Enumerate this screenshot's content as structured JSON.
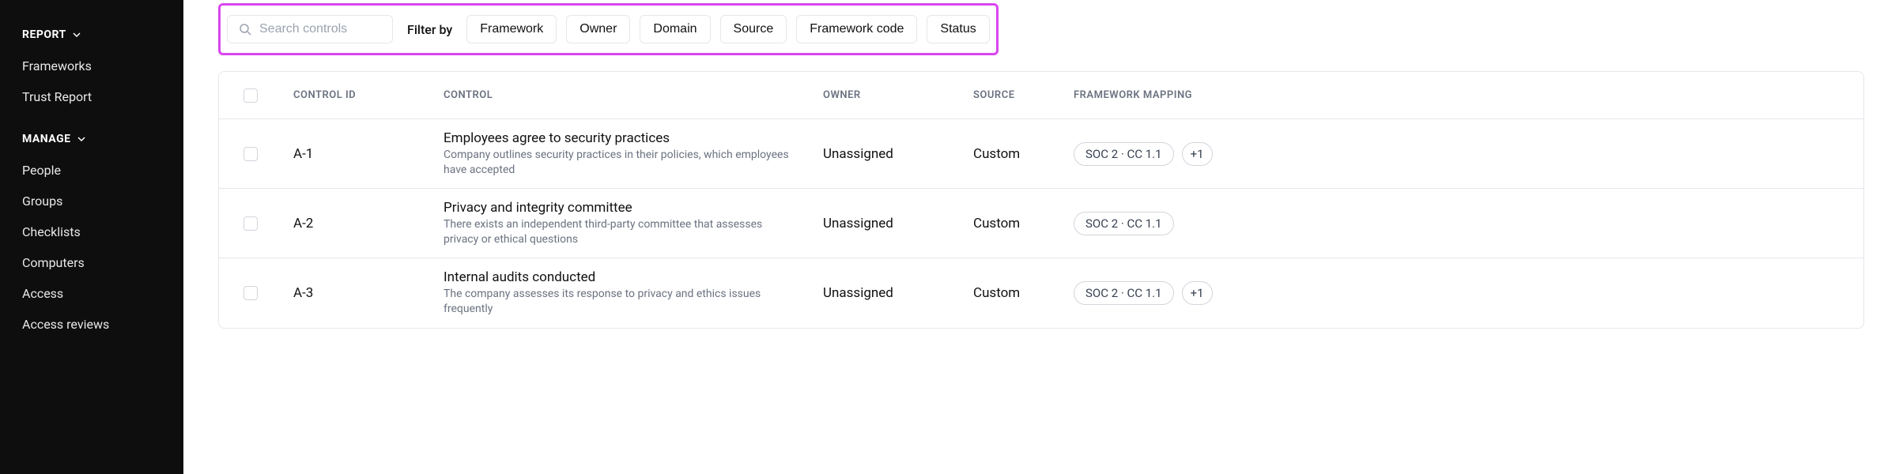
{
  "sidebar": {
    "sections": [
      {
        "label": "REPORT",
        "items": [
          {
            "label": "Frameworks"
          },
          {
            "label": "Trust Report"
          }
        ]
      },
      {
        "label": "MANAGE",
        "items": [
          {
            "label": "People"
          },
          {
            "label": "Groups"
          },
          {
            "label": "Checklists"
          },
          {
            "label": "Computers"
          },
          {
            "label": "Access"
          },
          {
            "label": "Access reviews"
          }
        ]
      }
    ]
  },
  "toolbar": {
    "search_placeholder": "Search controls",
    "filter_by_label": "Filter by",
    "filters": [
      "Framework",
      "Owner",
      "Domain",
      "Source",
      "Framework code",
      "Status"
    ]
  },
  "table": {
    "headers": {
      "control_id": "CONTROL ID",
      "control": "CONTROL",
      "owner": "OWNER",
      "source": "SOURCE",
      "mapping": "FRAMEWORK MAPPING"
    },
    "rows": [
      {
        "id": "A-1",
        "title": "Employees agree to security practices",
        "desc": "Company outlines security practices in their policies, which employees have accepted",
        "owner": "Unassigned",
        "source": "Custom",
        "mapping": "SOC 2 · CC 1.1",
        "extra": "+1"
      },
      {
        "id": "A-2",
        "title": "Privacy and integrity committee",
        "desc": "There exists an independent third-party committee that assesses privacy or ethical questions",
        "owner": "Unassigned",
        "source": "Custom",
        "mapping": "SOC 2 · CC 1.1",
        "extra": ""
      },
      {
        "id": "A-3",
        "title": "Internal audits conducted",
        "desc": "The company assesses its response to privacy and ethics issues frequently",
        "owner": "Unassigned",
        "source": "Custom",
        "mapping": "SOC 2 · CC 1.1",
        "extra": "+1"
      }
    ]
  }
}
